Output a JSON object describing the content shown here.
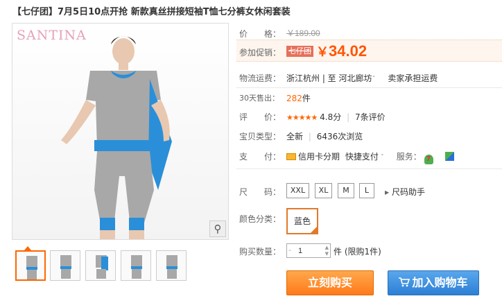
{
  "title": "【七仔团】7月5日10点开抢 新款真丝拼接短袖T恤七分裤女休闲套装",
  "gallery": {
    "brand": "SANTINA",
    "zoom_icon": "magnifier-icon",
    "thumbnail_count": 5
  },
  "price": {
    "label": "价　　格：",
    "original": "￥189.00",
    "promo_label": "参加促销：",
    "promo_tag": "七仔团",
    "currency": "￥",
    "promo_price": "34.02"
  },
  "shipping": {
    "label": "物流运费：",
    "from": "浙江杭州 | 至",
    "to": "河北廊坊",
    "to_arrow": "ˇ",
    "fee": "卖家承担运费"
  },
  "sales": {
    "label": "30天售出：",
    "count": "282",
    "unit": "件"
  },
  "rating": {
    "label": "评　　价：",
    "stars": "★★★★★",
    "score": "4.8分",
    "divider": "|",
    "reviews": "7条评价"
  },
  "item_type": {
    "label": "宝贝类型：",
    "value": "全新",
    "divider": "|",
    "views": "6436次浏览"
  },
  "payment": {
    "label": "支　　付：",
    "credit": "信用卡分期",
    "quick": "快捷支付",
    "quick_arrow": "ˇ",
    "service_label": "服务：",
    "service_badge": "7"
  },
  "size": {
    "label": "尺　　码：",
    "options": [
      "XXL",
      "XL",
      "M",
      "L"
    ],
    "helper": "尺码助手",
    "helper_arrow": "▶"
  },
  "color": {
    "label": "颜色分类：",
    "selected": "蓝色"
  },
  "quantity": {
    "label": "购买数量：",
    "value": "1",
    "minus": "-",
    "unit_limit": "件 (限购1件)"
  },
  "actions": {
    "buy_now": "立刻购买",
    "add_cart": "加入购物车",
    "cart_icon": "cart-icon"
  },
  "colors": {
    "accent": "#ff6600",
    "buy": "#ff8a2a",
    "cart": "#3c8ee0"
  }
}
